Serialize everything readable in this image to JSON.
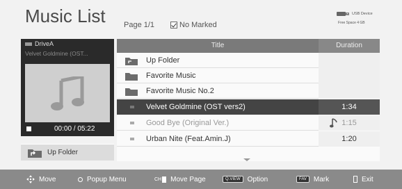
{
  "header": {
    "title": "Music List",
    "page": "Page 1/1",
    "marked": "No Marked",
    "usb": {
      "label": "USB Device",
      "free": "Free Space 4 GB"
    }
  },
  "now_playing": {
    "drive": "DriveA",
    "title": "Velvet Goldmine (OST...",
    "time": "00:00 / 05:22",
    "up_folder": "Up Folder"
  },
  "list": {
    "columns": {
      "title": "Title",
      "duration": "Duration"
    },
    "rows": [
      {
        "name": "Up Folder",
        "duration": "",
        "type": "up-folder"
      },
      {
        "name": "Favorite Music",
        "duration": "",
        "type": "folder"
      },
      {
        "name": "Favorite Music No.2",
        "duration": "",
        "type": "folder"
      },
      {
        "name": "Velvet Goldmine (OST vers2)",
        "duration": "1:34",
        "type": "file-selected"
      },
      {
        "name": "Good Bye (Original Ver.)",
        "duration": "1:15",
        "type": "file-playing"
      },
      {
        "name": "Urban Nite (Feat.Amin.J)",
        "duration": "1:20",
        "type": "file"
      }
    ]
  },
  "bottom_bar": {
    "move": "Move",
    "popup": "Popup Menu",
    "move_page_badge": "CH",
    "move_page": "Move Page",
    "option_badge": "Q.VIEW",
    "option": "Option",
    "mark_badge": "FAV",
    "mark": "Mark",
    "exit": "Exit"
  },
  "colors": {
    "header_bg": "#7a7a7a",
    "selected_row": "#444444",
    "bottom_bar": "#8a8a8a",
    "folder": "#6b6b6b"
  }
}
